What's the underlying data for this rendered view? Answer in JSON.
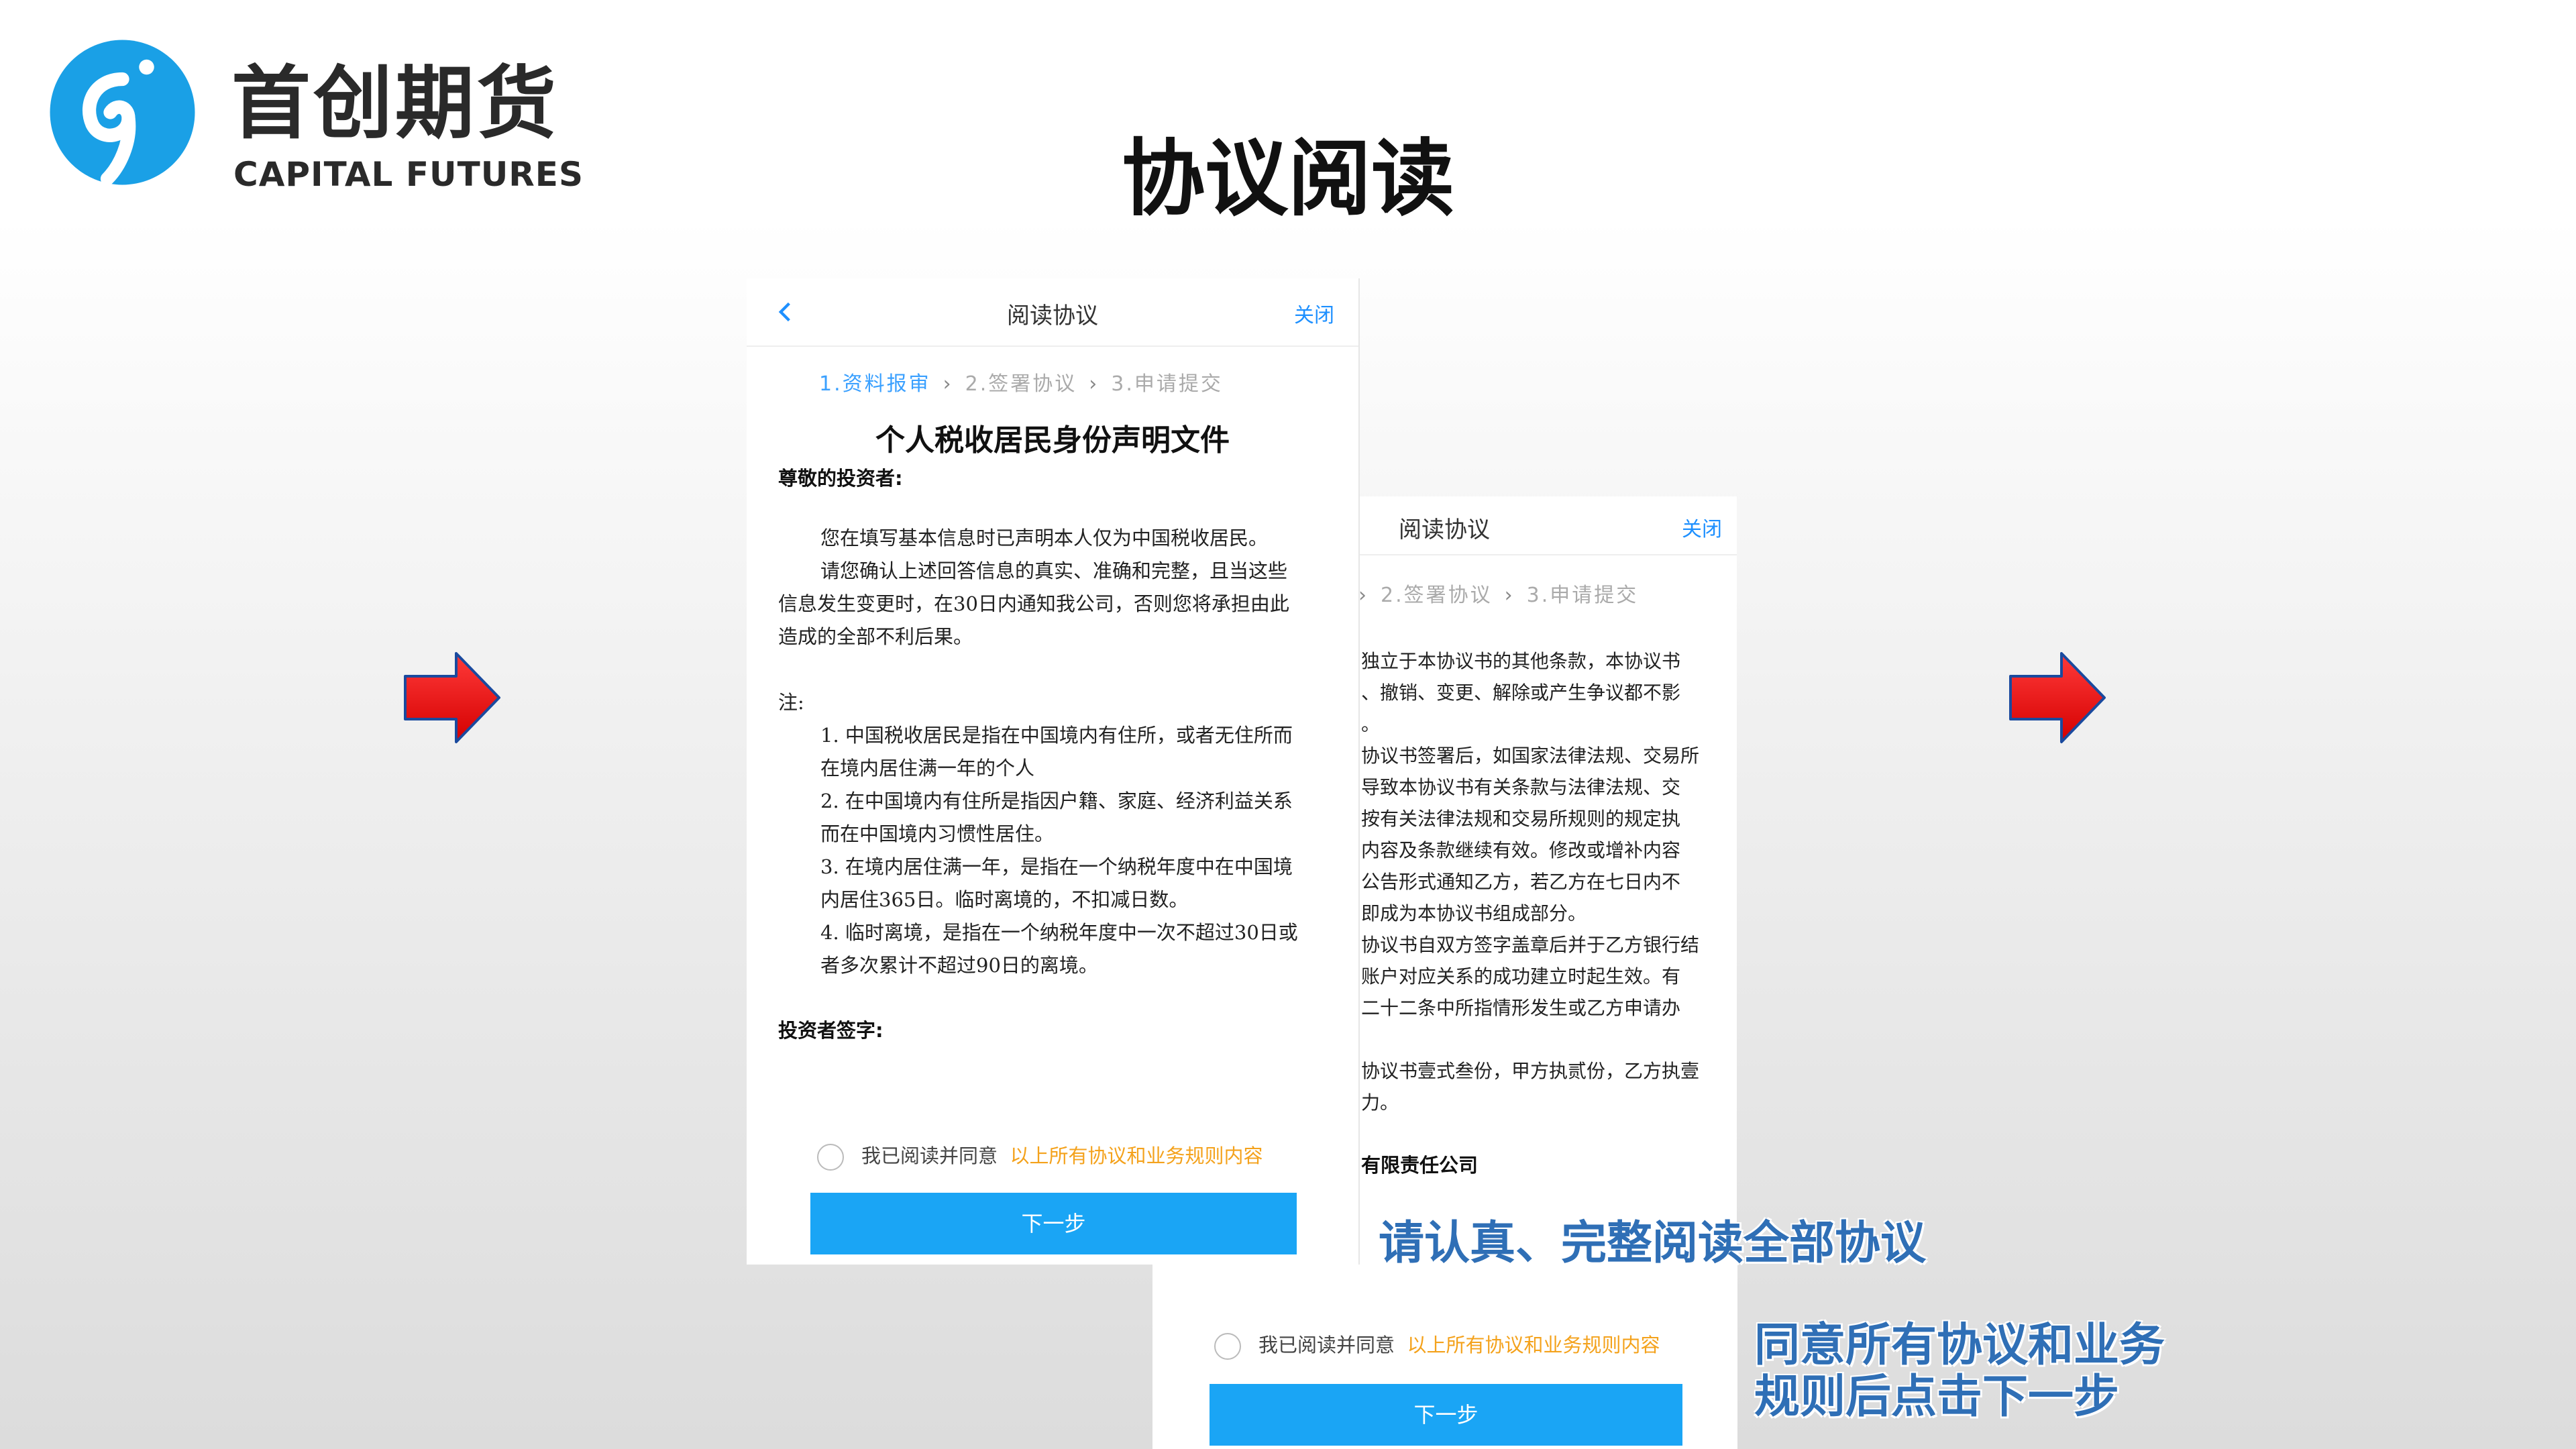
{
  "brand": {
    "name_cn": "首创期货",
    "name_en": "CAPITAL FUTURES",
    "color": "#1aa0e6"
  },
  "page_title": "协议阅读",
  "screen_a": {
    "nav": {
      "back_icon": "chevron-left-icon",
      "title": "阅读协议",
      "close": "关闭"
    },
    "steps": [
      "1.资料报审",
      "2.签署协议",
      "3.申请提交"
    ],
    "doc_title": "个人税收居民身份声明文件",
    "greeting": "尊敬的投资者:",
    "para1": "您在填写基本信息时已声明本人仅为中国税收居民。",
    "para2_line1": "请您确认上述回答信息的真实、准确和完整，且当这些",
    "para2_line2": "信息发生变更时，在30日内通知我公司，否则您将承担由此",
    "para2_line3": "造成的全部不利后果。",
    "note_label": "注:",
    "notes": [
      "1. 中国税收居民是指在中国境内有住所，或者无住所而",
      "在境内居住满一年的个人",
      "2. 在中国境内有住所是指因户籍、家庭、经济利益关系",
      "而在中国境内习惯性居住。",
      "3. 在境内居住满一年，是指在一个纳税年度中在中国境",
      "内居住365日。临时离境的，不扣减日数。",
      "4. 临时离境，是指在一个纳税年度中一次不超过30日或",
      "者多次累计不超过90日的离境。"
    ],
    "signature_label": "投资者签字:",
    "agree_text": "我已阅读并同意",
    "agree_link": "以上所有协议和业务规则内容",
    "next_button": "下一步"
  },
  "screen_b": {
    "nav": {
      "title": "阅读协议",
      "close": "关闭"
    },
    "steps": [
      "2.签署协议",
      "3.申请提交"
    ],
    "lines": [
      "独立于本协议书的其他条款，本协议书",
      "、撤销、变更、解除或产生争议都不影",
      "。",
      "协议书签署后，如国家法律法规、交易所",
      "导致本协议书有关条款与法律法规、交",
      "按有关法律法规和交易所规则的规定执",
      "内容及条款继续有效。修改或增补内容",
      "公告形式通知乙方，若乙方在七日内不",
      "即成为本协议书组成部分。",
      "协议书自双方签字盖章后并于乙方银行结",
      "账户对应关系的成功建立时起生效。有",
      "二十二条中所指情形发生或乙方申请办",
      "",
      "协议书壹式叁份，甲方执贰份，乙方执壹",
      "力。",
      "",
      "有限责任公司"
    ],
    "agree_text": "我已阅读并同意",
    "agree_link": "以上所有协议和业务规则内容",
    "next_button": "下一步"
  },
  "arrows": {
    "color": "#ee1111"
  },
  "captions": {
    "read_all": "请认真、完整阅读全部协议",
    "agree_line1": "同意所有协议和业务",
    "agree_line2": "规则后点击下一步"
  }
}
